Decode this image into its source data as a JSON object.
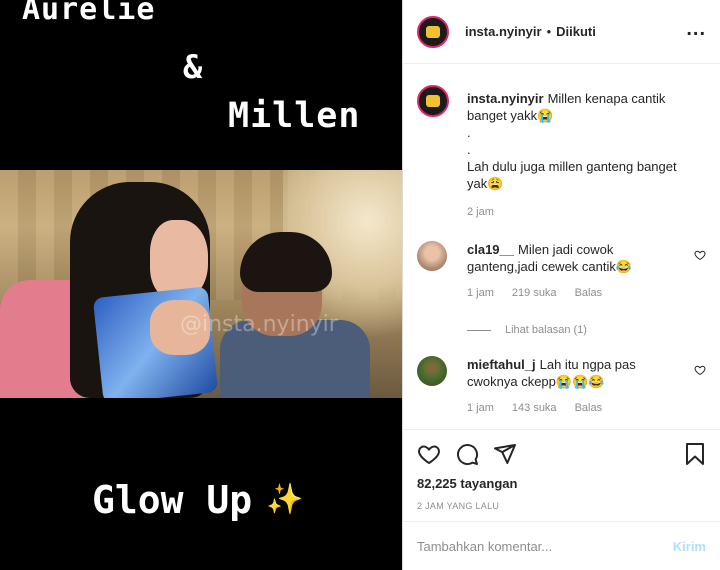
{
  "media": {
    "overlay_line1": "Aurelie",
    "overlay_line2": "&",
    "overlay_line3": "Millen",
    "overlay_bottom": "Glow Up",
    "sparkle": "✨",
    "watermark": "@insta.nyinyir"
  },
  "header": {
    "username": "insta.nyinyir",
    "separator": "•",
    "follow_label": "Diikuti",
    "more_label": "..."
  },
  "caption": {
    "username": "insta.nyinyir",
    "line1": "Millen kenapa cantik banget yakk😭",
    "line2": ".",
    "line3": ".",
    "line4": "Lah dulu juga millen ganteng banget yak😩",
    "time": "2 jam"
  },
  "comments": [
    {
      "username": "cla19__",
      "text": "Milen jadi cowok ganteng,jadi cewek cantik😂",
      "time": "1 jam",
      "likes": "219 suka",
      "reply_label": "Balas",
      "view_replies": "Lihat balasan (1)"
    },
    {
      "username": "mieftahul_j",
      "text": "Lah itu ngpa pas cwoknya ckepp😭😭😂",
      "time": "1 jam",
      "likes": "143 suka",
      "reply_label": "Balas"
    }
  ],
  "actions": {
    "views": "82,225 tayangan",
    "time_ago": "2 JAM YANG LALU"
  },
  "add_comment": {
    "placeholder": "Tambahkan komentar...",
    "send_label": "Kirim"
  },
  "colors": {
    "send_disabled": "#b2dffc",
    "muted": "#8e8e8e",
    "avatar_ring": "#e0246a"
  }
}
